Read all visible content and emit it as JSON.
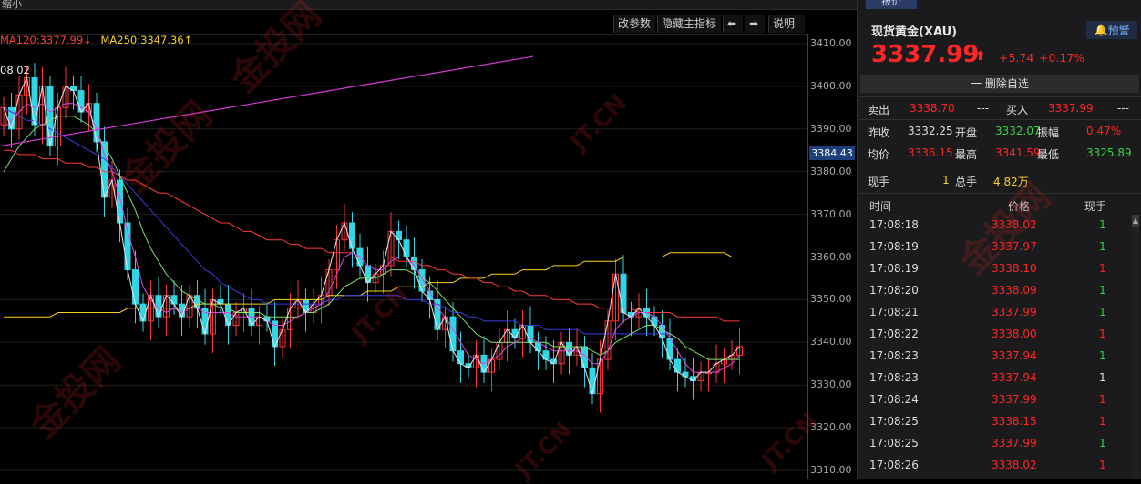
{
  "chart_header": {
    "shrink_label": "缩小",
    "buttons": [
      "改参数",
      "隐藏主指标",
      "⬅",
      "➡",
      "说明"
    ],
    "ma_legend": [
      {
        "text": "MA120:3377.99↓",
        "color": "#ff3b3b"
      },
      {
        "text": "MA250:3347.36↑",
        "color": "#f5d21b"
      }
    ],
    "high_label": "08.02"
  },
  "axis": {
    "ticks": [
      "3410.00",
      "3400.00",
      "3390.00",
      "3380.00",
      "3370.00",
      "3360.00",
      "3350.00",
      "3340.00",
      "3330.00",
      "3320.00",
      "3310.00"
    ],
    "current_label": "3384.43"
  },
  "chart_data": {
    "type": "candlestick",
    "y_range": [
      3310,
      3410
    ],
    "y_ticks": [
      3310,
      3320,
      3330,
      3340,
      3350,
      3360,
      3370,
      3380,
      3390,
      3400,
      3410
    ],
    "current_marker": 3384.43,
    "colors": {
      "up": "#ff3333",
      "down": "#2fd6e6",
      "ma120": "#ff3b3b",
      "ma250": "#f5d21b"
    },
    "closes": [
      3395,
      3390,
      3398,
      3402,
      3391,
      3400,
      3386,
      3395,
      3400,
      3399,
      3394,
      3396,
      3387,
      3374,
      3378,
      3368,
      3357,
      3349,
      3345,
      3351,
      3346,
      3351,
      3349,
      3346,
      3351,
      3348,
      3342,
      3350,
      3349,
      3344,
      3347,
      3348,
      3344,
      3346,
      3345,
      3339,
      3343,
      3348,
      3350,
      3347,
      3349,
      3351,
      3357,
      3364,
      3368,
      3362,
      3358,
      3354,
      3356,
      3358,
      3366,
      3364,
      3360,
      3357,
      3352,
      3350,
      3343,
      3346,
      3338,
      3335,
      3334,
      3337,
      3333,
      3336,
      3340,
      3343,
      3341,
      3344,
      3340,
      3338,
      3336,
      3335,
      3340,
      3337,
      3339,
      3334,
      3328,
      3336,
      3345,
      3356,
      3347,
      3346,
      3348,
      3346,
      3344,
      3341,
      3336,
      3333,
      3332,
      3331,
      3333,
      3333,
      3335,
      3336,
      3337,
      3339
    ],
    "ma_short": [
      3390,
      3392,
      3394,
      3396,
      3395,
      3396,
      3394,
      3395,
      3396,
      3396,
      3395,
      3394,
      3390,
      3384,
      3380,
      3374,
      3366,
      3360,
      3353,
      3350,
      3348,
      3347,
      3348,
      3347,
      3348,
      3348,
      3347,
      3347,
      3347,
      3347,
      3346,
      3346,
      3346,
      3346,
      3345,
      3344,
      3344,
      3345,
      3346,
      3347,
      3348,
      3349,
      3352,
      3356,
      3360,
      3361,
      3360,
      3358,
      3357,
      3357,
      3359,
      3360,
      3360,
      3358,
      3355,
      3352,
      3348,
      3346,
      3343,
      3340,
      3337,
      3336,
      3335,
      3336,
      3337,
      3339,
      3340,
      3341,
      3341,
      3340,
      3339,
      3338,
      3338,
      3338,
      3338,
      3337,
      3335,
      3335,
      3338,
      3343,
      3345,
      3346,
      3347,
      3347,
      3346,
      3344,
      3341,
      3338,
      3335,
      3333,
      3333,
      3333,
      3333,
      3334,
      3335,
      3337
    ],
    "ma_mid": [
      3380,
      3383,
      3386,
      3388,
      3390,
      3391,
      3392,
      3393,
      3393,
      3393,
      3392,
      3391,
      3389,
      3386,
      3383,
      3379,
      3375,
      3371,
      3366,
      3362,
      3359,
      3356,
      3354,
      3352,
      3351,
      3350,
      3349,
      3349,
      3348,
      3348,
      3347,
      3347,
      3347,
      3347,
      3346,
      3346,
      3346,
      3346,
      3346,
      3347,
      3347,
      3348,
      3349,
      3351,
      3353,
      3354,
      3355,
      3355,
      3355,
      3356,
      3357,
      3357,
      3357,
      3356,
      3355,
      3354,
      3352,
      3350,
      3348,
      3346,
      3344,
      3342,
      3341,
      3340,
      3340,
      3340,
      3340,
      3340,
      3340,
      3340,
      3340,
      3339,
      3339,
      3339,
      3339,
      3339,
      3338,
      3337,
      3338,
      3340,
      3341,
      3342,
      3343,
      3344,
      3344,
      3343,
      3342,
      3341,
      3339,
      3338,
      3337,
      3336,
      3336,
      3336,
      3336,
      3336
    ],
    "ma_long": [
      3395,
      3394,
      3393,
      3392,
      3392,
      3391,
      3390,
      3389,
      3388,
      3387,
      3386,
      3385,
      3384,
      3383,
      3381,
      3379,
      3377,
      3375,
      3373,
      3371,
      3369,
      3367,
      3365,
      3363,
      3361,
      3359,
      3357,
      3356,
      3354,
      3353,
      3352,
      3351,
      3350,
      3350,
      3349,
      3349,
      3349,
      3349,
      3349,
      3349,
      3349,
      3349,
      3350,
      3350,
      3351,
      3351,
      3351,
      3351,
      3351,
      3351,
      3351,
      3351,
      3350,
      3350,
      3350,
      3349,
      3349,
      3348,
      3347,
      3347,
      3346,
      3346,
      3345,
      3345,
      3345,
      3345,
      3345,
      3344,
      3344,
      3344,
      3343,
      3343,
      3343,
      3343,
      3343,
      3342,
      3342,
      3342,
      3342,
      3342,
      3342,
      3342,
      3342,
      3342,
      3342,
      3342,
      3342,
      3341,
      3341,
      3341,
      3341,
      3341,
      3341,
      3341,
      3341,
      3341
    ],
    "ma120_values": [
      3385,
      3385,
      3384,
      3384,
      3384,
      3383,
      3383,
      3383,
      3382,
      3382,
      3382,
      3381,
      3381,
      3380,
      3380,
      3379,
      3378,
      3378,
      3377,
      3376,
      3375,
      3375,
      3374,
      3373,
      3372,
      3371,
      3370,
      3369,
      3368,
      3368,
      3367,
      3366,
      3366,
      3365,
      3364,
      3364,
      3364,
      3363,
      3363,
      3362,
      3362,
      3362,
      3361,
      3361,
      3361,
      3361,
      3360,
      3360,
      3360,
      3360,
      3360,
      3359,
      3359,
      3359,
      3358,
      3358,
      3357,
      3357,
      3356,
      3356,
      3355,
      3355,
      3354,
      3354,
      3353,
      3353,
      3352,
      3352,
      3351,
      3351,
      3351,
      3350,
      3350,
      3350,
      3349,
      3349,
      3349,
      3348,
      3348,
      3348,
      3348,
      3348,
      3347,
      3347,
      3347,
      3347,
      3347,
      3346,
      3346,
      3346,
      3346,
      3346,
      3346,
      3345,
      3345,
      3345
    ],
    "ma250_values": [
      3346,
      3346,
      3346,
      3346,
      3346,
      3346,
      3346,
      3347,
      3347,
      3347,
      3347,
      3347,
      3347,
      3347,
      3347,
      3347,
      3348,
      3348,
      3348,
      3348,
      3348,
      3348,
      3348,
      3348,
      3348,
      3349,
      3349,
      3349,
      3349,
      3349,
      3349,
      3349,
      3349,
      3349,
      3349,
      3350,
      3350,
      3350,
      3350,
      3350,
      3350,
      3350,
      3351,
      3351,
      3351,
      3351,
      3351,
      3352,
      3352,
      3352,
      3352,
      3353,
      3353,
      3353,
      3353,
      3354,
      3354,
      3354,
      3354,
      3355,
      3355,
      3355,
      3355,
      3356,
      3356,
      3356,
      3356,
      3357,
      3357,
      3357,
      3357,
      3358,
      3358,
      3358,
      3358,
      3359,
      3359,
      3359,
      3359,
      3359,
      3360,
      3360,
      3360,
      3360,
      3360,
      3360,
      3361,
      3361,
      3361,
      3361,
      3361,
      3361,
      3361,
      3361,
      3360,
      3360
    ],
    "trendline": [
      3386,
      3407
    ]
  },
  "panel": {
    "tab_label": "报价",
    "instrument": "现货黄金(XAU)",
    "alert_button": "预警",
    "price": "3337.99",
    "arrow": "⬆",
    "change_abs": "+5.74",
    "change_pct": "+0.17%",
    "remove_watch": "一 删除自选",
    "sell_label": "卖出",
    "sell_price": "3338.70",
    "sell_vol": "---",
    "buy_label": "买入",
    "buy_price": "3337.99",
    "buy_vol": "---",
    "stats": [
      [
        {
          "label": "昨收",
          "value": "3332.25",
          "color": "white"
        },
        {
          "label": "开盘",
          "value": "3332.07",
          "color": "green"
        },
        {
          "label": "振幅",
          "value": "0.47%",
          "color": "red"
        }
      ],
      [
        {
          "label": "均价",
          "value": "3336.15",
          "color": "red"
        },
        {
          "label": "最高",
          "value": "3341.59",
          "color": "red"
        },
        {
          "label": "最低",
          "value": "3325.89",
          "color": "green"
        }
      ]
    ],
    "vol_label": "现手",
    "vol_value": "1",
    "total_label": "总手",
    "total_value": "4.82万",
    "trade_headers": [
      "时间",
      "价格",
      "现手"
    ],
    "trades": [
      {
        "time": "17:08:18",
        "price": "3338.02",
        "vol": "1",
        "color": "green"
      },
      {
        "time": "17:08:19",
        "price": "3337.97",
        "vol": "1",
        "color": "green"
      },
      {
        "time": "17:08:19",
        "price": "3338.10",
        "vol": "1",
        "color": "red"
      },
      {
        "time": "17:08:20",
        "price": "3338.09",
        "vol": "1",
        "color": "green"
      },
      {
        "time": "17:08:21",
        "price": "3337.99",
        "vol": "1",
        "color": "green"
      },
      {
        "time": "17:08:22",
        "price": "3338.00",
        "vol": "1",
        "color": "red"
      },
      {
        "time": "17:08:23",
        "price": "3337.94",
        "vol": "1",
        "color": "green"
      },
      {
        "time": "17:08:23",
        "price": "3337.94",
        "vol": "1",
        "color": "white"
      },
      {
        "time": "17:08:24",
        "price": "3337.99",
        "vol": "1",
        "color": "red"
      },
      {
        "time": "17:08:25",
        "price": "3338.15",
        "vol": "1",
        "color": "red"
      },
      {
        "time": "17:08:25",
        "price": "3337.99",
        "vol": "1",
        "color": "green"
      },
      {
        "time": "17:08:26",
        "price": "3338.02",
        "vol": "1",
        "color": "red"
      }
    ]
  },
  "watermark": {
    "text1": "金投网",
    "text2": "JT.CN"
  }
}
